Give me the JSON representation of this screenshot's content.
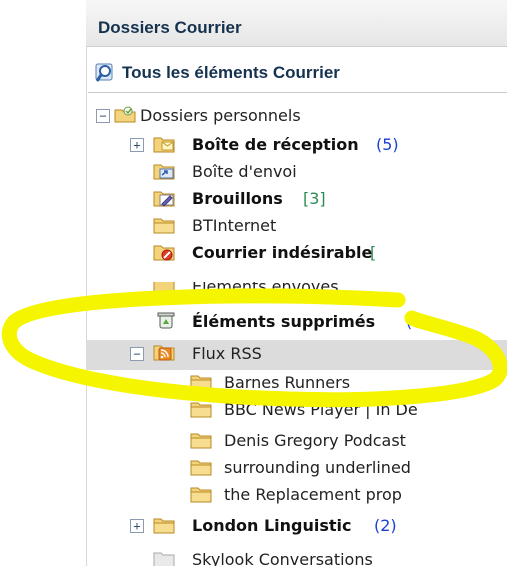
{
  "header": {
    "title": "Dossiers Courrier"
  },
  "all_mail": {
    "label": "Tous les éléments Courrier"
  },
  "tree": {
    "root": {
      "label": "Dossiers personnels"
    },
    "inbox": {
      "label": "Boîte de réception",
      "count": "(5)"
    },
    "outbox": {
      "label": "Boîte d'envoi"
    },
    "drafts": {
      "label": "Brouillons",
      "count": "[3]"
    },
    "btinternet": {
      "label": "BTInternet"
    },
    "junk": {
      "label": "Courrier indésirable",
      "count": "[!"
    },
    "sent": {
      "label": "Éléments envoyés"
    },
    "deleted": {
      "label": "Éléments supprimés",
      "count": "("
    },
    "rss": {
      "label": "Flux RSS"
    },
    "rss_children": [
      {
        "label": "Barnes Runners"
      },
      {
        "label": "BBC News Player | In De"
      },
      {
        "label": "Denis Gregory Podcast"
      },
      {
        "label": "surrounding underlined"
      },
      {
        "label": "the Replacement prop"
      }
    ],
    "london": {
      "label": "London Linguistic",
      "count": "(2)"
    },
    "skylook": {
      "label": "Skylook Conversations"
    }
  },
  "colors": {
    "highlight": "#f5f500",
    "count_blue": "#1a3fd1",
    "count_green": "#2e8b57"
  }
}
